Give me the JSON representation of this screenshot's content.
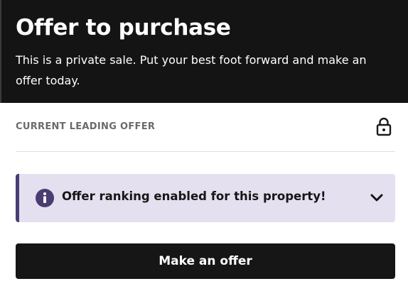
{
  "header": {
    "title": "Offer to purchase",
    "subtitle": "This is a private sale. Put your best foot forward and make an offer today."
  },
  "leading_offer": {
    "label": "CURRENT LEADING OFFER",
    "icon": "lock-icon"
  },
  "ranking_banner": {
    "text": "Offer ranking enabled for this property!",
    "info_icon": "info-icon",
    "toggle_icon": "chevron-down-icon"
  },
  "actions": {
    "make_offer_label": "Make an offer"
  },
  "colors": {
    "header_bg": "#141414",
    "banner_bg": "#e4e0ef",
    "banner_accent": "#4a3d73",
    "button_bg": "#161616",
    "label_gray": "#6a6a6a"
  }
}
